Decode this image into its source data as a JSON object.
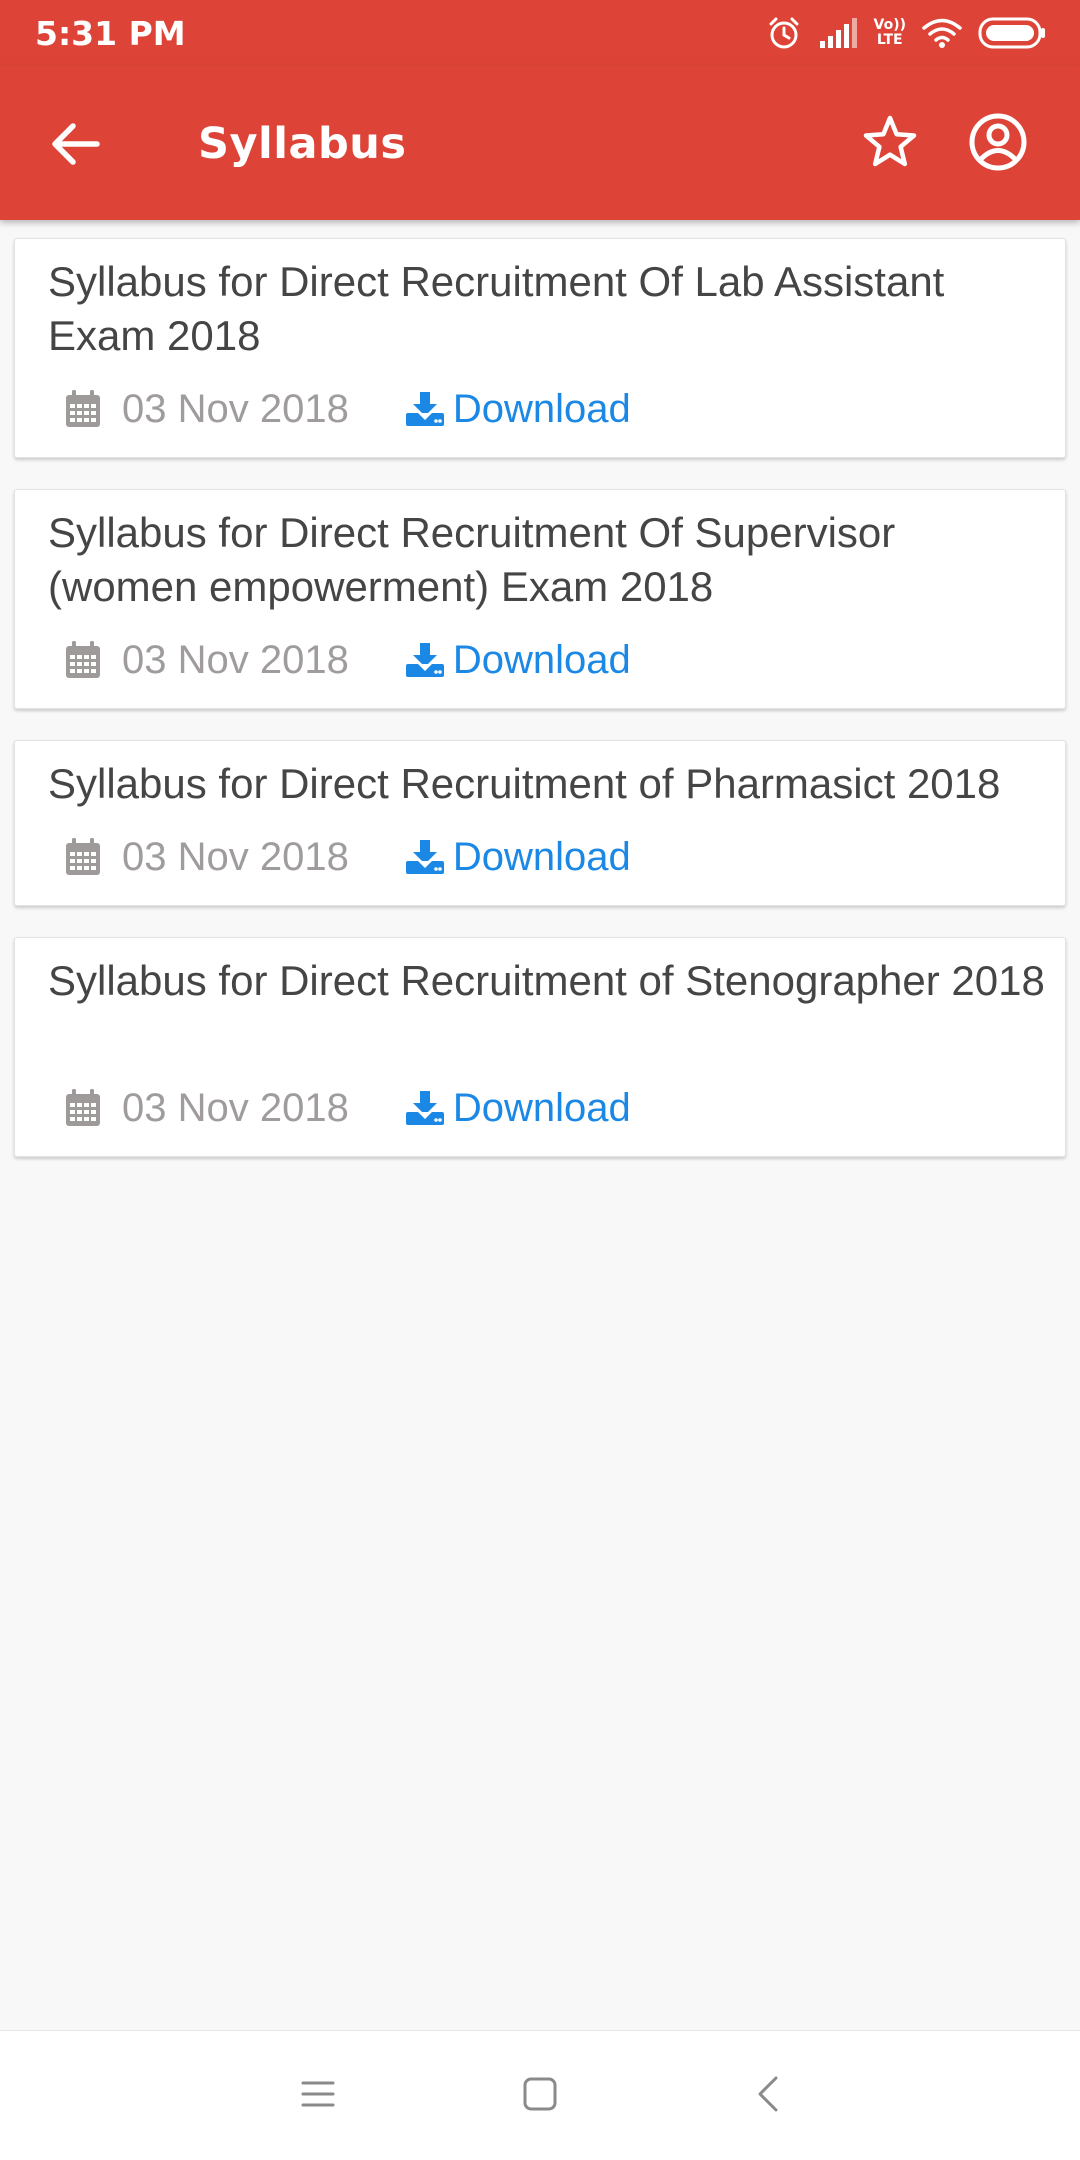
{
  "status_bar": {
    "time": "5:31 PM",
    "icons": [
      "alarm-icon",
      "signal-icon",
      "volte-icon",
      "wifi-icon",
      "battery-icon"
    ],
    "volte_line1": "Vo))",
    "volte_line2": "LTE"
  },
  "app_bar": {
    "title": "Syllabus",
    "back_icon": "arrow-back-icon",
    "favorite_icon": "star-outline-icon",
    "account_icon": "account-circle-icon",
    "color": "#dd4437"
  },
  "items": [
    {
      "title": "Syllabus for Direct Recruitment Of Lab Assistant Exam 2018",
      "date": "03 Nov 2018",
      "download_label": "Download"
    },
    {
      "title": "Syllabus for Direct Recruitment Of Supervisor (women empowerment) Exam 2018",
      "date": "03 Nov 2018",
      "download_label": "Download"
    },
    {
      "title": "Syllabus for Direct Recruitment of Pharmasict 2018",
      "date": "03 Nov 2018",
      "download_label": "Download"
    },
    {
      "title": "Syllabus for Direct Recruitment of Stenographer 2018",
      "date": "03 Nov 2018",
      "download_label": "Download"
    }
  ],
  "colors": {
    "accent": "#dd4437",
    "link": "#1c88e5",
    "muted_text": "#a09c9c",
    "title_text": "#454545",
    "background": "#f8f8f8"
  },
  "nav_bar": {
    "buttons": [
      "menu-icon",
      "home-square-icon",
      "back-chevron-icon"
    ]
  }
}
